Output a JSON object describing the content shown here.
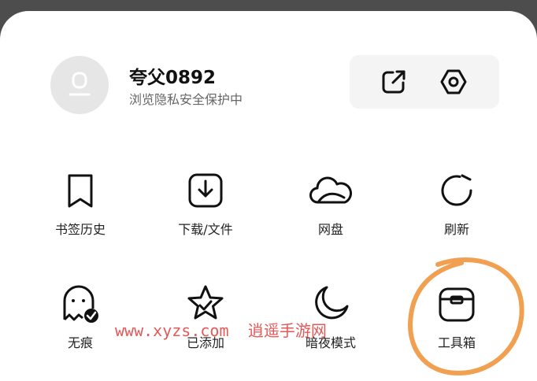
{
  "profile": {
    "username": "夸父0892",
    "subtitle": "浏览隐私安全保护中"
  },
  "header_actions": [
    {
      "icon": "share-edit-icon"
    },
    {
      "icon": "settings-hex-icon"
    }
  ],
  "grid": {
    "row1": [
      {
        "label": "书签历史",
        "icon": "bookmark-icon"
      },
      {
        "label": "下载/文件",
        "icon": "download-icon"
      },
      {
        "label": "网盘",
        "icon": "cloud-icon"
      },
      {
        "label": "刷新",
        "icon": "refresh-icon"
      }
    ],
    "row2": [
      {
        "label": "无痕",
        "icon": "ghost-icon"
      },
      {
        "label": "已添加",
        "icon": "star-icon"
      },
      {
        "label": "暗夜模式",
        "icon": "moon-icon"
      },
      {
        "label": "工具箱",
        "icon": "toolbox-icon"
      }
    ]
  },
  "watermark": {
    "url": "www.xyzs.com",
    "site": "逍遥手游网"
  },
  "colors": {
    "overlay": "#4d4d4d",
    "sheet": "#ffffff",
    "icon_stroke": "#111111",
    "highlight": "#f0a050",
    "watermark": "#e23a3a"
  }
}
